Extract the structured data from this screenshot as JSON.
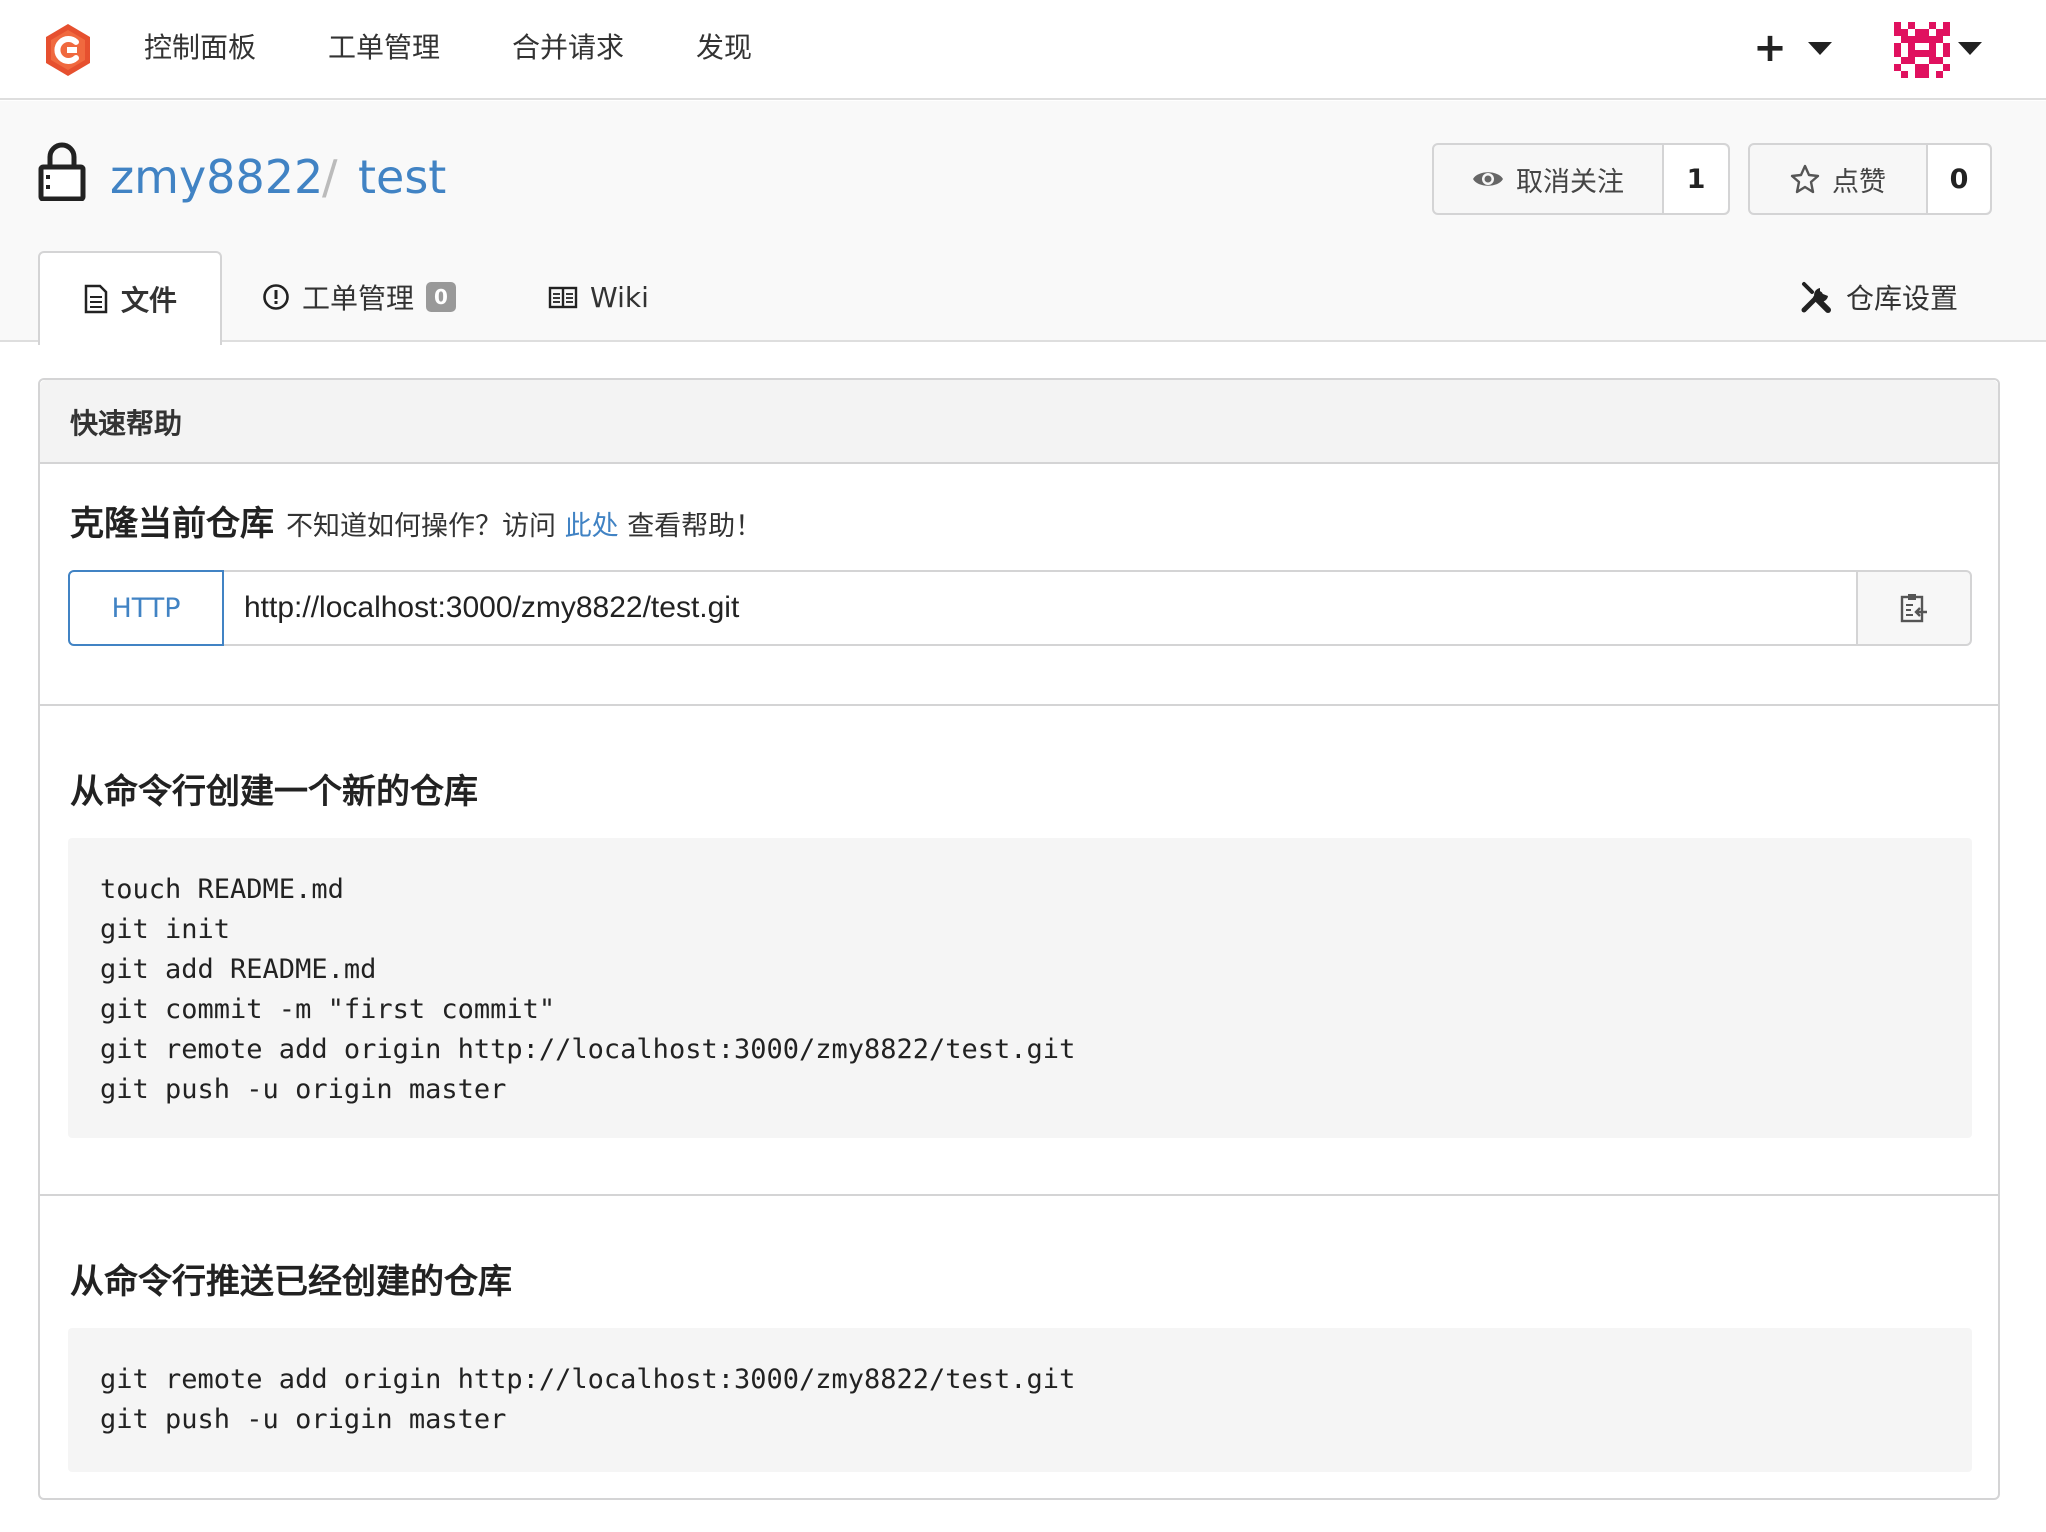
{
  "nav": {
    "items": [
      "控制面板",
      "工单管理",
      "合并请求",
      "发现"
    ],
    "plus_label": "+"
  },
  "repo": {
    "owner": "zmy8822",
    "separator": "/",
    "name": "test",
    "watch": {
      "label": "取消关注",
      "count": "1"
    },
    "star": {
      "label": "点赞",
      "count": "0"
    }
  },
  "tabs": {
    "files": "文件",
    "issues": "工单管理",
    "issues_count": "0",
    "wiki": "Wiki",
    "settings": "仓库设置"
  },
  "quick_help": {
    "title": "快速帮助",
    "clone_title": "克隆当前仓库",
    "clone_hint_prefix": "不知道如何操作？访问",
    "clone_hint_link": "此处",
    "clone_hint_suffix": "查看帮助！",
    "protocol": "HTTP",
    "clone_url": "http://localhost:3000/zmy8822/test.git",
    "new_repo_title": "从命令行创建一个新的仓库",
    "new_repo_lines": [
      "touch README.md",
      "git init",
      "git add README.md",
      "git commit -m \"first commit\"",
      "git remote add origin http://localhost:3000/zmy8822/test.git",
      "git push -u origin master"
    ],
    "push_repo_title": "从命令行推送已经创建的仓库",
    "push_repo_lines": [
      "git remote add origin http://localhost:3000/zmy8822/test.git",
      "git push -u origin master"
    ]
  },
  "colors": {
    "link": "#4183c4",
    "logo": "#e6502f",
    "avatar": "#e0115f"
  }
}
